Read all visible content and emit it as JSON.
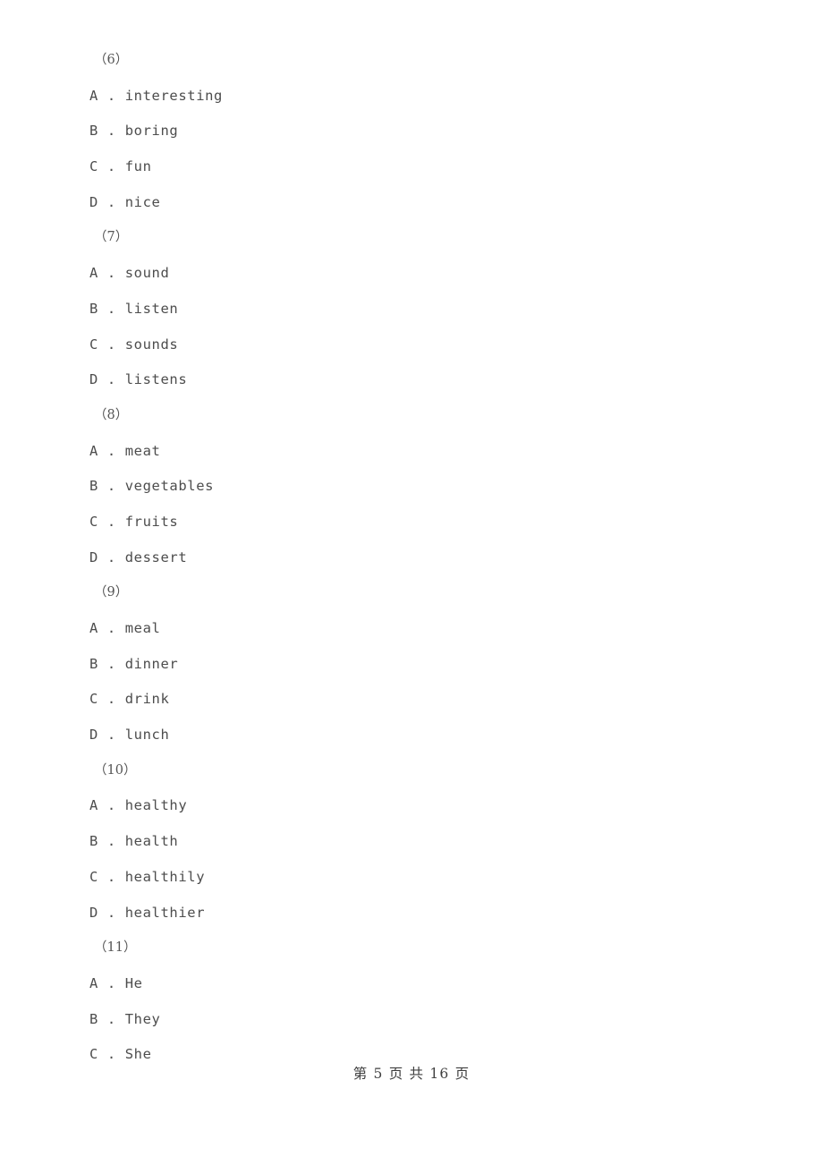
{
  "document": {
    "type": "exam-paper-page",
    "text_color": "#4d4d4d",
    "background_color": "#ffffff"
  },
  "questions": [
    {
      "number": "（6）",
      "options": [
        {
          "letter": "A",
          "separator": " . ",
          "text": "interesting"
        },
        {
          "letter": "B",
          "separator": " . ",
          "text": "boring"
        },
        {
          "letter": "C",
          "separator": " . ",
          "text": "fun"
        },
        {
          "letter": "D",
          "separator": " . ",
          "text": "nice"
        }
      ]
    },
    {
      "number": "（7）",
      "options": [
        {
          "letter": "A",
          "separator": " . ",
          "text": "sound"
        },
        {
          "letter": "B",
          "separator": " . ",
          "text": "listen"
        },
        {
          "letter": "C",
          "separator": " . ",
          "text": "sounds"
        },
        {
          "letter": "D",
          "separator": " . ",
          "text": "listens"
        }
      ]
    },
    {
      "number": "（8）",
      "options": [
        {
          "letter": "A",
          "separator": " . ",
          "text": "meat"
        },
        {
          "letter": "B",
          "separator": " . ",
          "text": "vegetables"
        },
        {
          "letter": "C",
          "separator": " . ",
          "text": "fruits"
        },
        {
          "letter": "D",
          "separator": " . ",
          "text": "dessert"
        }
      ]
    },
    {
      "number": "（9）",
      "options": [
        {
          "letter": "A",
          "separator": " . ",
          "text": "meal"
        },
        {
          "letter": "B",
          "separator": " . ",
          "text": "dinner"
        },
        {
          "letter": "C",
          "separator": " . ",
          "text": "drink"
        },
        {
          "letter": "D",
          "separator": " . ",
          "text": "lunch"
        }
      ]
    },
    {
      "number": "（10）",
      "options": [
        {
          "letter": "A",
          "separator": " . ",
          "text": "healthy"
        },
        {
          "letter": "B",
          "separator": " . ",
          "text": "health"
        },
        {
          "letter": "C",
          "separator": " . ",
          "text": "healthily"
        },
        {
          "letter": "D",
          "separator": " . ",
          "text": "healthier"
        }
      ]
    },
    {
      "number": "（11）",
      "options": [
        {
          "letter": "A",
          "separator": " . ",
          "text": "He"
        },
        {
          "letter": "B",
          "separator": " . ",
          "text": "They"
        },
        {
          "letter": "C",
          "separator": " . ",
          "text": "She"
        }
      ]
    }
  ],
  "footer": {
    "text": "第 5 页 共 16 页",
    "current_page": "5",
    "total_pages": "16"
  }
}
